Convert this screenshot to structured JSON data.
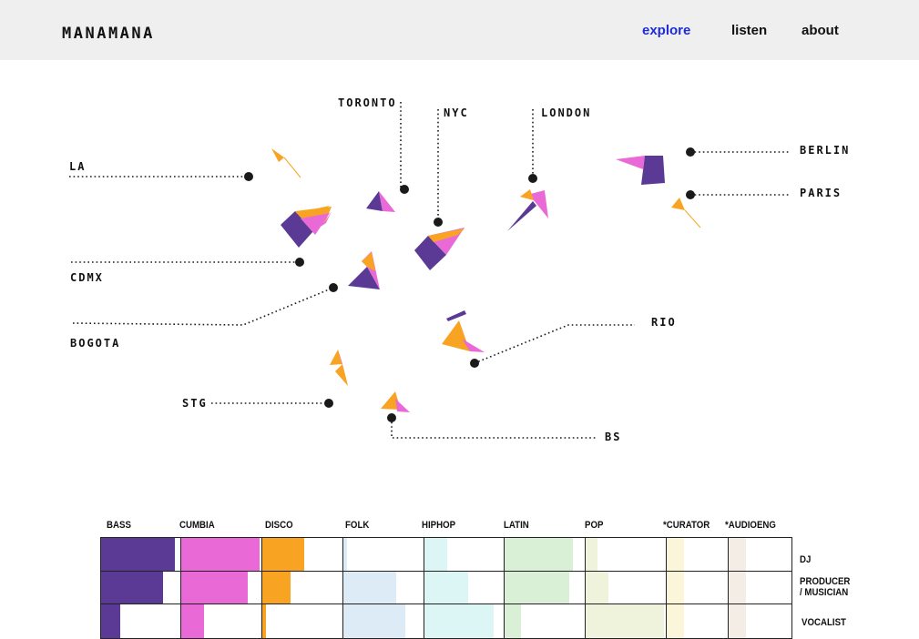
{
  "brand": {
    "logo": "MANAMANA"
  },
  "nav": [
    {
      "label": "explore",
      "active": true
    },
    {
      "label": "listen",
      "active": false
    },
    {
      "label": "about",
      "active": false
    }
  ],
  "map": {
    "colors": {
      "purple": "#5b3a96",
      "pink": "#e96ad6",
      "orange": "#f9a323",
      "dot": "#1a1a1a"
    },
    "cities": [
      "TORONTO",
      "NYC",
      "LONDON",
      "LA",
      "BERLIN",
      "PARIS",
      "CDMX",
      "BOGOTA",
      "RIO",
      "STG",
      "BS"
    ]
  },
  "genre_grid": {
    "columns": [
      {
        "label": "BASS",
        "color": "#5b3a96"
      },
      {
        "label": "CUMBIA",
        "color": "#e96ad6"
      },
      {
        "label": "DISCO",
        "color": "#f9a323"
      },
      {
        "label": "FOLK",
        "color": "#dcebf6"
      },
      {
        "label": "HIPHOP",
        "color": "#dcf6f5"
      },
      {
        "label": "LATIN",
        "color": "#daf0d6"
      },
      {
        "label": "POP",
        "color": "#eff3dc"
      },
      {
        "label": "*CURATOR",
        "color": "#fbf6d9"
      },
      {
        "label": "*AUDIOENG",
        "color": "#f4ede6"
      }
    ],
    "rows": [
      {
        "label": "DJ",
        "levels": [
          0.92,
          0.97,
          0.52,
          0.05,
          0.28,
          0.85,
          0.15,
          0.28,
          0.28
        ]
      },
      {
        "label": "PRODUCER / MUSICIAN",
        "levels": [
          0.78,
          0.83,
          0.35,
          0.65,
          0.55,
          0.8,
          0.28,
          0.28,
          0.28
        ]
      },
      {
        "label": "VOCALIST",
        "levels": [
          0.24,
          0.28,
          0.05,
          0.77,
          0.87,
          0.2,
          0.97,
          0.28,
          0.28
        ]
      }
    ]
  }
}
